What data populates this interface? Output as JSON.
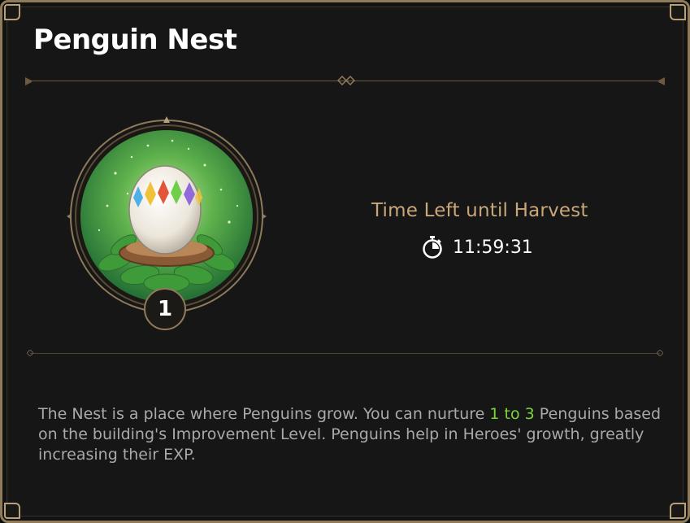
{
  "panel": {
    "title": "Penguin Nest"
  },
  "nest": {
    "level": "1",
    "icon": "penguin-egg-in-nest"
  },
  "harvest": {
    "label": "Time Left until Harvest",
    "timer_icon": "stopwatch-icon",
    "time_left": "11:59:31"
  },
  "description": {
    "part1": "The Nest is a place where Penguins grow. You can nurture ",
    "highlight": "1 to 3",
    "part2": " Penguins based on the building's Improvement Level. Penguins help in Heroes' growth, greatly increasing their EXP."
  },
  "colors": {
    "title": "#ffffff",
    "harvest_label": "#c9a77a",
    "highlight": "#7ed33a",
    "description": "#a9a9a9",
    "border": "#8f7a5a"
  }
}
